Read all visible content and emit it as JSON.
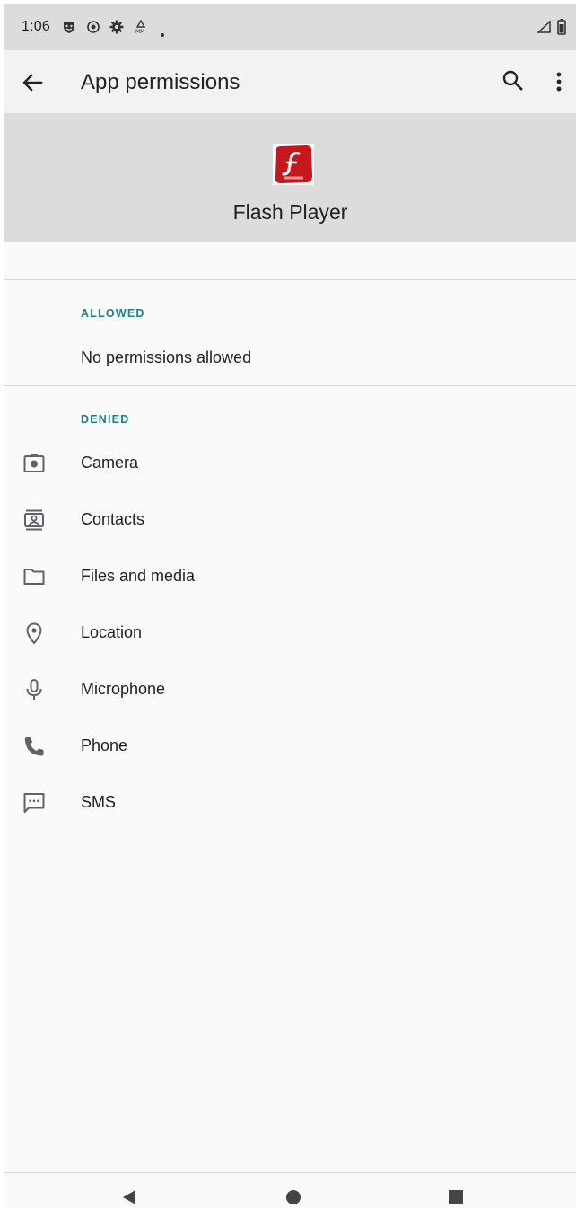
{
  "status_bar": {
    "time": "1:06",
    "left_icons": [
      "shield-face-icon",
      "record-icon",
      "gear-icon",
      "mm-icon",
      "dot-icon"
    ],
    "right_icons": [
      "signal-icon",
      "battery-icon"
    ]
  },
  "app_bar": {
    "title": "App permissions",
    "back_icon": "arrow-back-icon",
    "search_icon": "search-icon",
    "more_icon": "more-vert-icon"
  },
  "app": {
    "name": "Flash Player",
    "icon_caption": "SWF · FLV",
    "brand_color": "#c8161d"
  },
  "allowed": {
    "header": "ALLOWED",
    "empty_text": "No permissions allowed"
  },
  "denied": {
    "header": "DENIED",
    "items": [
      {
        "label": "Camera",
        "icon": "camera-icon"
      },
      {
        "label": "Contacts",
        "icon": "contacts-icon"
      },
      {
        "label": "Files and media",
        "icon": "folder-icon"
      },
      {
        "label": "Location",
        "icon": "location-pin-icon"
      },
      {
        "label": "Microphone",
        "icon": "microphone-icon"
      },
      {
        "label": "Phone",
        "icon": "phone-icon"
      },
      {
        "label": "SMS",
        "icon": "sms-icon"
      }
    ]
  },
  "nav_bar": {
    "buttons": [
      "back-triangle-icon",
      "home-circle-icon",
      "recents-square-icon"
    ]
  },
  "colors": {
    "accent": "#1f7f86",
    "header_bg": "#dcdcdc",
    "background": "#fafafa"
  }
}
